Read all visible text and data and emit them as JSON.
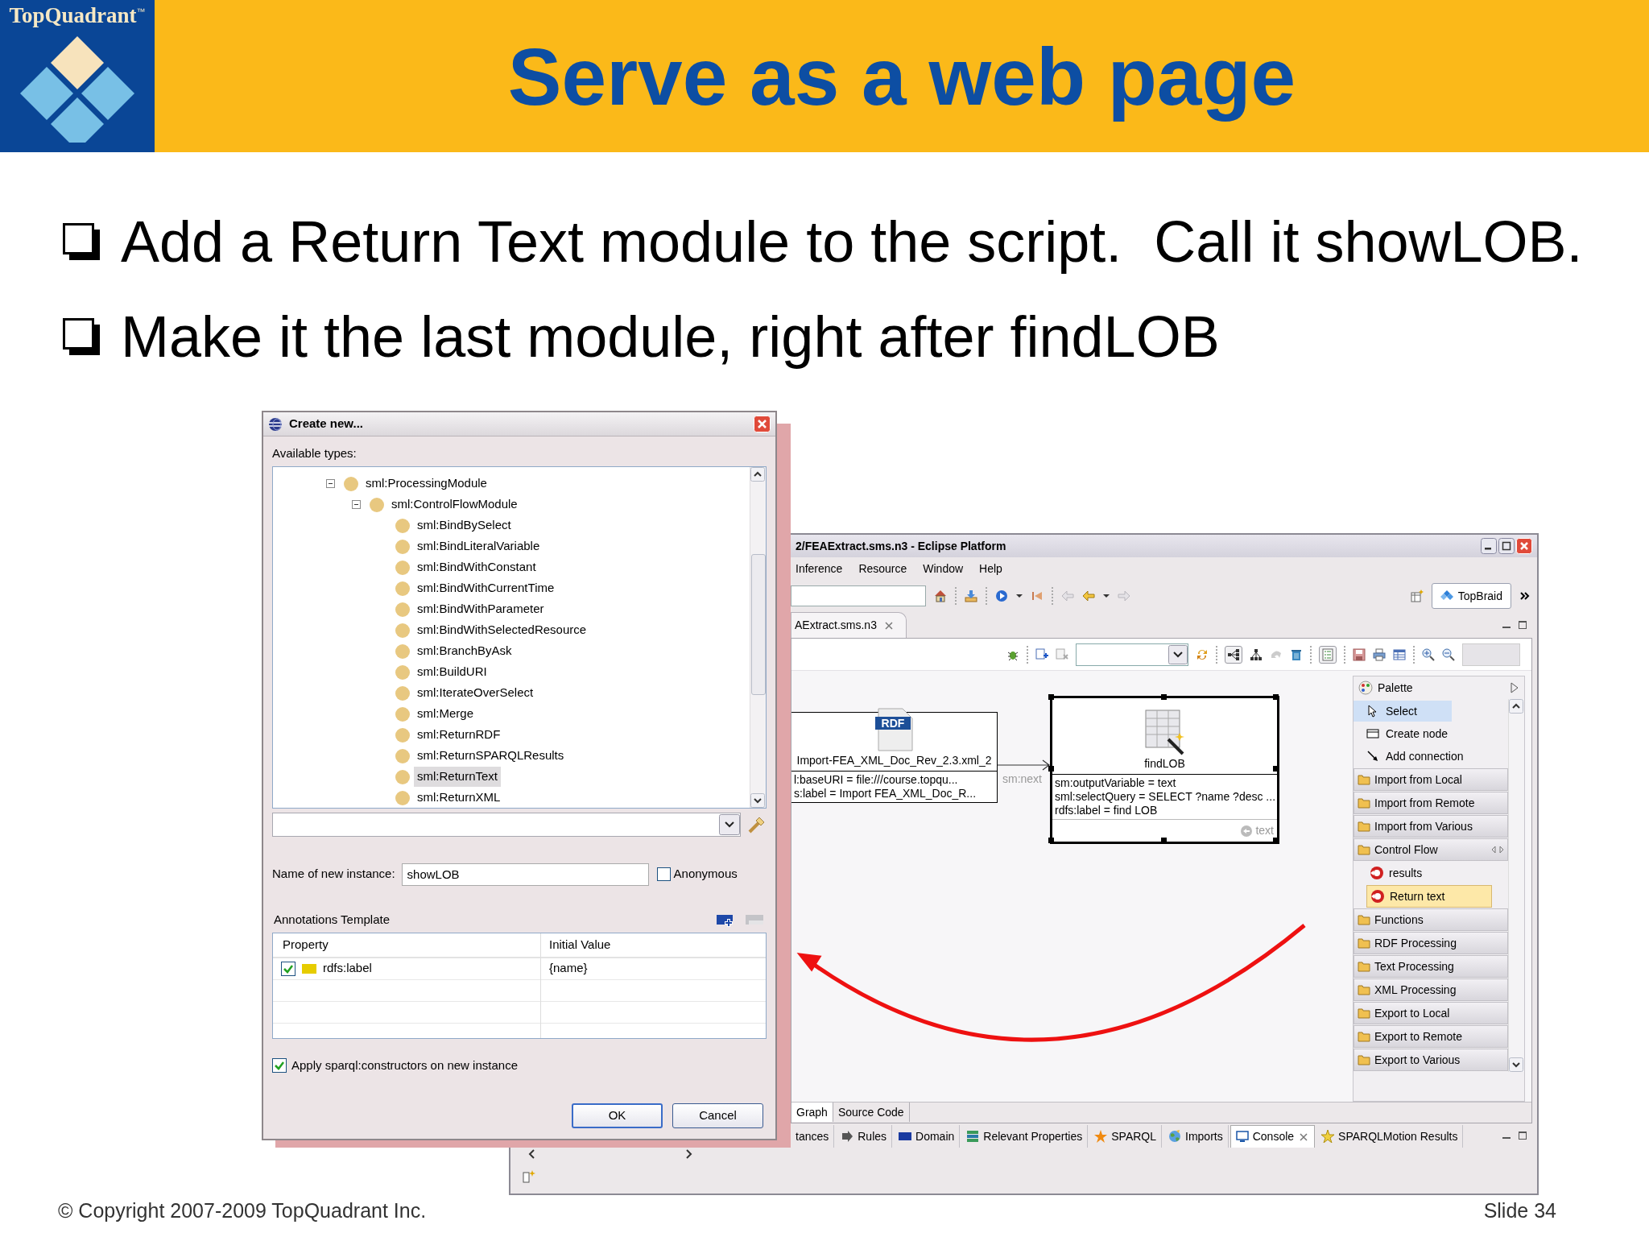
{
  "header": {
    "logo_name": "TopQuadrant",
    "logo_trademark": "™",
    "title": "Serve as a web page"
  },
  "bullets": [
    "Add a Return Text module to the script.  Call it showLOB.",
    "Make it the last module, right after findLOB"
  ],
  "dialog": {
    "title": "Create new...",
    "types_label": "Available types:",
    "tree": [
      {
        "label": "sml:ProcessingModule",
        "expanded": true,
        "selected": false,
        "children": [
          {
            "label": "sml:ControlFlowModule",
            "expanded": true,
            "selected": false,
            "children": [
              {
                "label": "sml:BindBySelect",
                "selected": false
              },
              {
                "label": "sml:BindLiteralVariable",
                "selected": false
              },
              {
                "label": "sml:BindWithConstant",
                "selected": false
              },
              {
                "label": "sml:BindWithCurrentTime",
                "selected": false
              },
              {
                "label": "sml:BindWithParameter",
                "selected": false
              },
              {
                "label": "sml:BindWithSelectedResource",
                "selected": false
              },
              {
                "label": "sml:BranchByAsk",
                "selected": false
              },
              {
                "label": "sml:BuildURI",
                "selected": false
              },
              {
                "label": "sml:IterateOverSelect",
                "selected": false
              },
              {
                "label": "sml:Merge",
                "selected": false
              },
              {
                "label": "sml:ReturnRDF",
                "selected": false
              },
              {
                "label": "sml:ReturnSPARQLResults",
                "selected": false
              },
              {
                "label": "sml:ReturnText",
                "selected": true
              },
              {
                "label": "sml:ReturnXML",
                "selected": false
              }
            ]
          }
        ]
      }
    ],
    "name_label": "Name of new instance:",
    "name_value": "showLOB",
    "anonymous": {
      "label": "Anonymous",
      "checked": false
    },
    "annotations_label": "Annotations Template",
    "table": {
      "columns": [
        "Property",
        "Initial Value"
      ],
      "rows": [
        {
          "checked": true,
          "property": "rdfs:label",
          "value": "{name}"
        }
      ]
    },
    "apply": {
      "label": "Apply sparql:constructors on new instance",
      "checked": true
    },
    "buttons": [
      {
        "label": "OK",
        "default": true
      },
      {
        "label": "Cancel",
        "default": false
      }
    ]
  },
  "eclipse": {
    "title": "2/FEAExtract.sms.n3 - Eclipse Platform",
    "menu": [
      "Inference",
      "Resource",
      "Window",
      "Help"
    ],
    "perspective": "TopBraid",
    "editor_tab": "AExtract.sms.n3",
    "nodes": [
      {
        "kind": "rdf",
        "icon_label": "RDF",
        "title": "Import-FEA_XML_Doc_Rev_2.3.xml_2",
        "properties": [
          "l:baseURI = file:///course.topqu...",
          "s:label = Import FEA_XML_Doc_R..."
        ],
        "selected": false
      },
      {
        "kind": "table",
        "title": "findLOB",
        "properties": [
          "sm:outputVariable = text",
          "sml:selectQuery = SELECT ?name ?desc ...",
          "rdfs:label = find LOB"
        ],
        "output": "text",
        "selected": true
      }
    ],
    "edge_label": "sm:next",
    "palette": {
      "title": "Palette",
      "tools": [
        {
          "label": "Select",
          "selected": true
        },
        {
          "label": "Create node",
          "selected": false
        },
        {
          "label": "Add connection",
          "selected": false
        }
      ],
      "items": [
        {
          "kind": "drawer",
          "label": "Import from Local",
          "expanded": false
        },
        {
          "kind": "drawer",
          "label": "Import from Remote",
          "expanded": false
        },
        {
          "kind": "drawer",
          "label": "Import from Various",
          "expanded": false
        },
        {
          "kind": "drawer",
          "label": "Control Flow",
          "expanded": true
        },
        {
          "kind": "entry",
          "label": "results",
          "selected": false
        },
        {
          "kind": "entry",
          "label": "Return text",
          "selected": true
        },
        {
          "kind": "drawer",
          "label": "Functions",
          "expanded": false
        },
        {
          "kind": "drawer",
          "label": "RDF Processing",
          "expanded": false
        },
        {
          "kind": "drawer",
          "label": "Text Processing",
          "expanded": false
        },
        {
          "kind": "drawer",
          "label": "XML Processing",
          "expanded": false
        },
        {
          "kind": "drawer",
          "label": "Export to Local",
          "expanded": false
        },
        {
          "kind": "drawer",
          "label": "Export to Remote",
          "expanded": false
        },
        {
          "kind": "drawer",
          "label": "Export to Various",
          "expanded": false
        }
      ]
    },
    "editor_views": [
      {
        "label": "Graph",
        "selected": true
      },
      {
        "label": "Source Code",
        "selected": false
      }
    ],
    "views": [
      {
        "label": "tances",
        "selected": false
      },
      {
        "label": "Rules",
        "selected": false
      },
      {
        "label": "Domain",
        "selected": false
      },
      {
        "label": "Relevant Properties",
        "selected": false
      },
      {
        "label": "SPARQL",
        "selected": false
      },
      {
        "label": "Imports",
        "selected": false
      },
      {
        "label": "Console",
        "selected": true
      },
      {
        "label": "SPARQLMotion Results",
        "selected": false
      }
    ]
  },
  "footer": {
    "copyright": "© Copyright 2007-2009 TopQuadrant Inc.",
    "slide": "Slide 34"
  }
}
